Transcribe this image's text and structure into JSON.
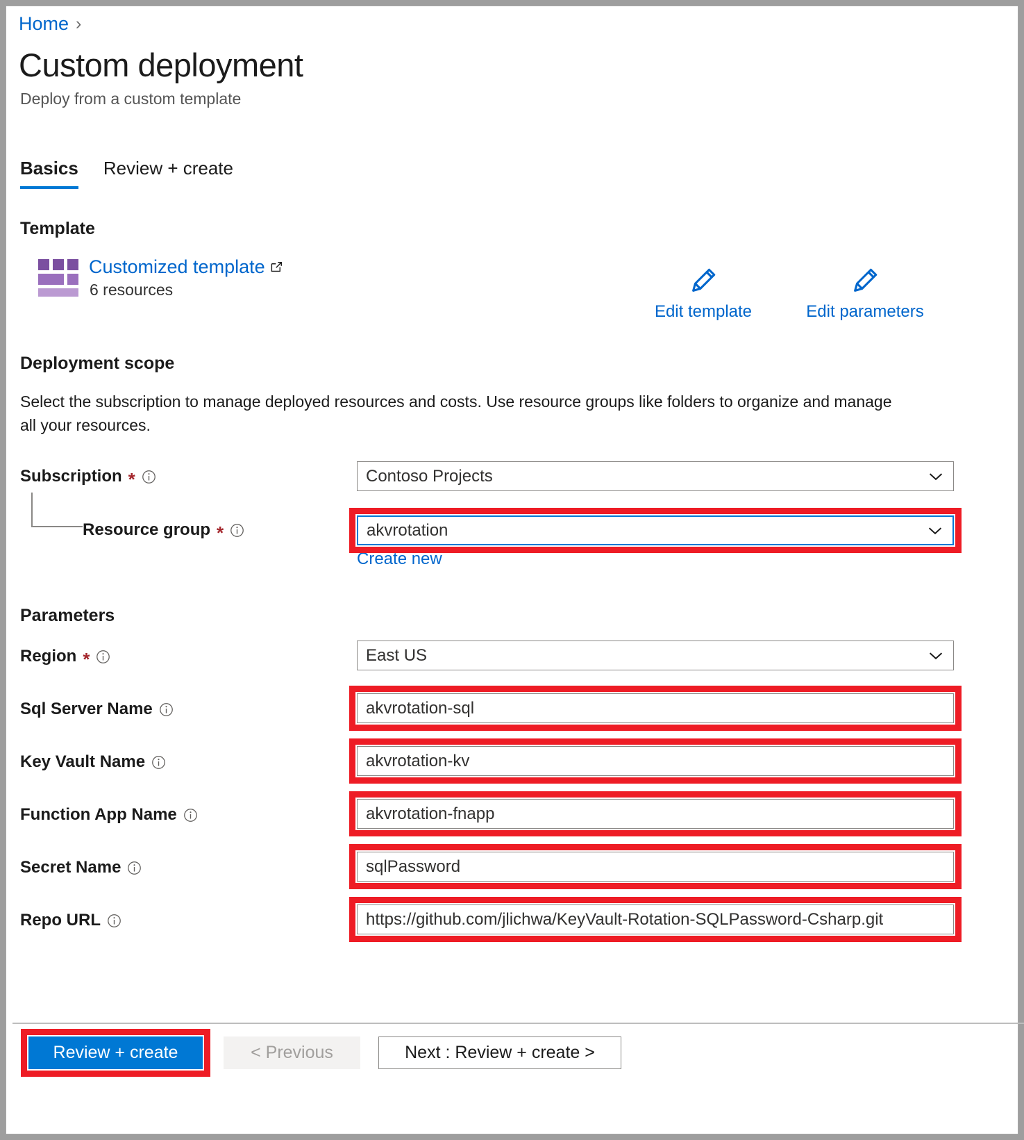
{
  "breadcrumb": {
    "home": "Home",
    "separator": "›"
  },
  "header": {
    "title": "Custom deployment",
    "subtitle": "Deploy from a custom template"
  },
  "tabs": [
    {
      "label": "Basics",
      "active": true
    },
    {
      "label": "Review + create",
      "active": false
    }
  ],
  "template_section": {
    "heading": "Template",
    "link_label": "Customized template",
    "resources_count": "6 resources",
    "edit_template_label": "Edit template",
    "edit_parameters_label": "Edit parameters"
  },
  "deployment_scope": {
    "heading": "Deployment scope",
    "description": "Select the subscription to manage deployed resources and costs. Use resource groups like folders to organize and manage all your resources.",
    "subscription": {
      "label": "Subscription",
      "required": "*",
      "value": "Contoso Projects"
    },
    "resource_group": {
      "label": "Resource group",
      "required": "*",
      "value": "akvrotation",
      "create_new_label": "Create new"
    }
  },
  "parameters": {
    "heading": "Parameters",
    "fields": [
      {
        "label": "Region",
        "required": "*",
        "value": "East US",
        "type": "select"
      },
      {
        "label": "Sql Server Name",
        "required": "",
        "value": "akvrotation-sql",
        "type": "text"
      },
      {
        "label": "Key Vault Name",
        "required": "",
        "value": "akvrotation-kv",
        "type": "text"
      },
      {
        "label": "Function App Name",
        "required": "",
        "value": "akvrotation-fnapp",
        "type": "text"
      },
      {
        "label": "Secret Name",
        "required": "",
        "value": "sqlPassword",
        "type": "text"
      },
      {
        "label": "Repo URL",
        "required": "",
        "value": "https://github.com/jlichwa/KeyVault-Rotation-SQLPassword-Csharp.git",
        "type": "text"
      }
    ]
  },
  "footer": {
    "review_create_label": "Review + create",
    "previous_label": "< Previous",
    "next_label": "Next : Review + create >"
  },
  "colors": {
    "accent_blue": "#0078d4",
    "link_blue": "#0066cc",
    "highlight_red": "#ee1c25",
    "required_red": "#a4262c",
    "template_purple_dark": "#7b4fa0",
    "template_purple_mid": "#9a6fbd",
    "template_purple_light": "#bb9ad2"
  },
  "icons": {
    "info": "info-icon",
    "chevron_down": "chevron-down-icon",
    "external_link": "external-link-icon",
    "pencil": "pencil-icon",
    "template_grid": "template-grid-icon"
  }
}
